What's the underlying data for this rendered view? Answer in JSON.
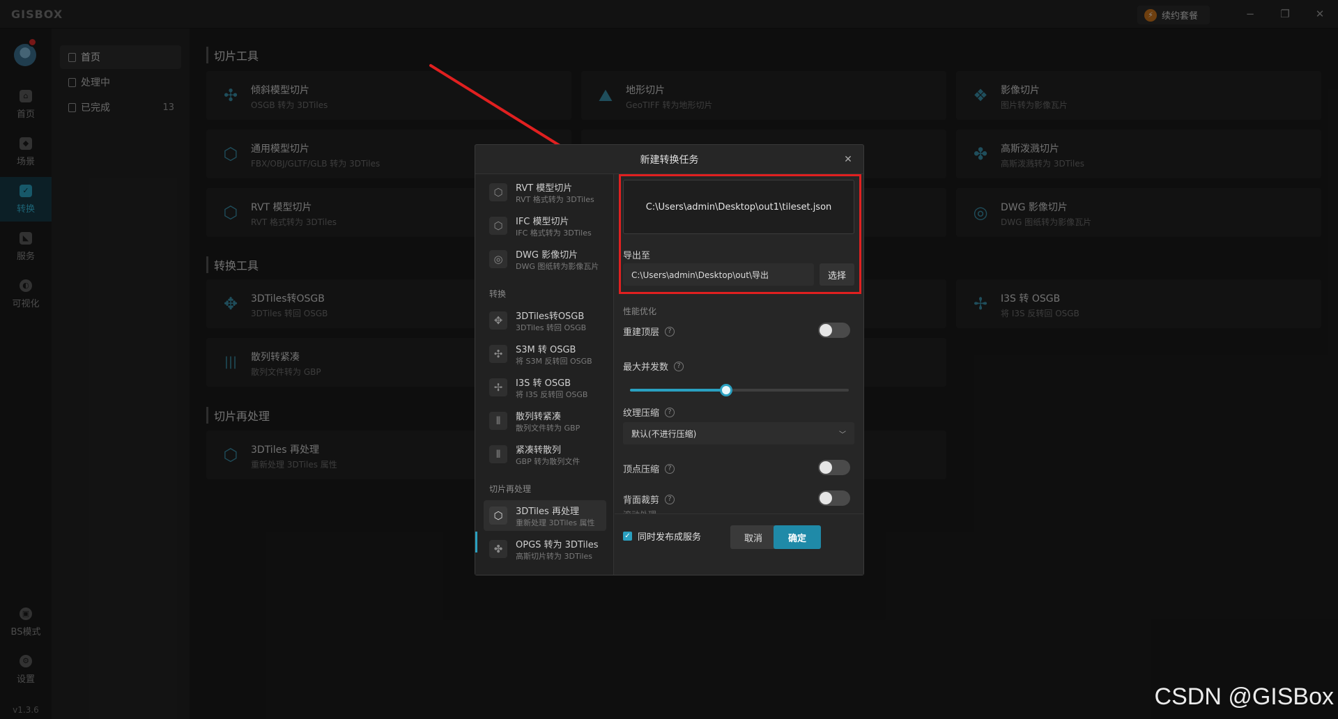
{
  "app": {
    "logo": "GISBOX",
    "renew_label": "续约套餐",
    "version": "v1.3.6",
    "win_min": "−",
    "win_restore": "❐",
    "win_close": "✕"
  },
  "leftbar": {
    "items": [
      {
        "label": "首页",
        "icon": "home-icon"
      },
      {
        "label": "场景",
        "icon": "scene-icon"
      },
      {
        "label": "转换",
        "icon": "convert-icon"
      },
      {
        "label": "服务",
        "icon": "service-icon"
      },
      {
        "label": "可视化",
        "icon": "visualize-icon"
      }
    ],
    "bottom": [
      {
        "label": "BS模式",
        "icon": "lock-icon"
      },
      {
        "label": "设置",
        "icon": "gear-icon"
      }
    ]
  },
  "subnav": {
    "items": [
      {
        "label": "首页",
        "count": ""
      },
      {
        "label": "处理中",
        "count": ""
      },
      {
        "label": "已完成",
        "count": "13"
      }
    ]
  },
  "main": {
    "sections": [
      {
        "title": "切片工具",
        "cards": [
          {
            "title": "倾斜模型切片",
            "sub": "OSGB 转为 3DTiles",
            "glyph": "✣"
          },
          {
            "title": "地形切片",
            "sub": "GeoTIFF 转为地形切片",
            "glyph": "⛰"
          },
          {
            "title": "影像切片",
            "sub": "图片转为影像瓦片",
            "glyph": "❖"
          },
          {
            "title": "通用模型切片",
            "sub": "FBX/OBJ/GLTF/GLB 转为 3DTiles",
            "glyph": "⬡"
          },
          {
            "title": "",
            "sub": "",
            "glyph": ""
          },
          {
            "title": "高斯泼溅切片",
            "sub": "高斯泼溅转为 3DTiles",
            "glyph": "✤"
          },
          {
            "title": "RVT 模型切片",
            "sub": "RVT 格式转为 3DTiles",
            "glyph": "⬡"
          },
          {
            "title": "",
            "sub": "",
            "glyph": ""
          },
          {
            "title": "DWG 影像切片",
            "sub": "DWG 图纸转为影像瓦片",
            "glyph": "◎"
          }
        ]
      },
      {
        "title": "转换工具",
        "cards": [
          {
            "title": "3DTiles转OSGB",
            "sub": "3DTiles 转回 OSGB",
            "glyph": "✥"
          },
          {
            "title": "",
            "sub": "",
            "glyph": ""
          },
          {
            "title": "I3S 转 OSGB",
            "sub": "将 I3S 反转回 OSGB",
            "glyph": "✢"
          },
          {
            "title": "散列转紧凑",
            "sub": "散列文件转为 GBP",
            "glyph": "|||"
          },
          {
            "title": "",
            "sub": "",
            "glyph": ""
          }
        ]
      },
      {
        "title": "切片再处理",
        "cards": [
          {
            "title": "3DTiles 再处理",
            "sub": "重新处理 3DTiles 属性",
            "glyph": "⬡"
          },
          {
            "title": "",
            "sub": "",
            "glyph": ""
          }
        ]
      }
    ]
  },
  "dialog": {
    "title": "新建转换任务",
    "close": "✕",
    "left": {
      "groups": [
        {
          "label": "转换"
        },
        {
          "label": "切片再处理"
        }
      ],
      "items": [
        {
          "title": "RVT 模型切片",
          "sub": "RVT 格式转为 3DTiles",
          "glyph": "⬡"
        },
        {
          "title": "IFC 模型切片",
          "sub": "IFC 格式转为 3DTiles",
          "glyph": "⬡"
        },
        {
          "title": "DWG 影像切片",
          "sub": "DWG 图纸转为影像瓦片",
          "glyph": "◎"
        },
        {
          "title": "3DTiles转OSGB",
          "sub": "3DTiles 转回 OSGB",
          "glyph": "✥"
        },
        {
          "title": "S3M 转 OSGB",
          "sub": "将 S3M 反转回 OSGB",
          "glyph": "✣"
        },
        {
          "title": "I3S 转 OSGB",
          "sub": "将 I3S 反转回 OSGB",
          "glyph": "✢"
        },
        {
          "title": "散列转紧凑",
          "sub": "散列文件转为 GBP",
          "glyph": "⦀"
        },
        {
          "title": "紧凑转散列",
          "sub": "GBP 转为散列文件",
          "glyph": "⦀"
        },
        {
          "title": "3DTiles 再处理",
          "sub": "重新处理 3DTiles 属性",
          "glyph": "⬡"
        },
        {
          "title": "OPGS 转为 3DTiles",
          "sub": "高斯切片转为 3DTiles",
          "glyph": "✤"
        }
      ]
    },
    "input_path": "C:\\Users\\admin\\Desktop\\out1\\tileset.json",
    "export_label": "导出至",
    "export_path": "C:\\Users\\admin\\Desktop\\out\\导出",
    "select_label": "选择",
    "perf_label": "性能优化",
    "rebuild_top_label": "重建顶层",
    "max_concurrency_label": "最大并发数",
    "max_concurrency_fraction": 0.44,
    "texture_compress_label": "纹理压缩",
    "texture_compress_value": "默认(不进行压缩)",
    "vertex_compress_label": "顶点压缩",
    "backface_cull_label": "背面裁剪",
    "cut_hint": "滚动处理",
    "publish_label": "同时发布成服务",
    "cancel_label": "取消",
    "ok_label": "确定",
    "help_glyph": "?"
  },
  "watermark": "CSDN @GISBox",
  "colors": {
    "accent": "#2aa0c0",
    "annotation": "#e02020",
    "card_bg": "#222222"
  }
}
